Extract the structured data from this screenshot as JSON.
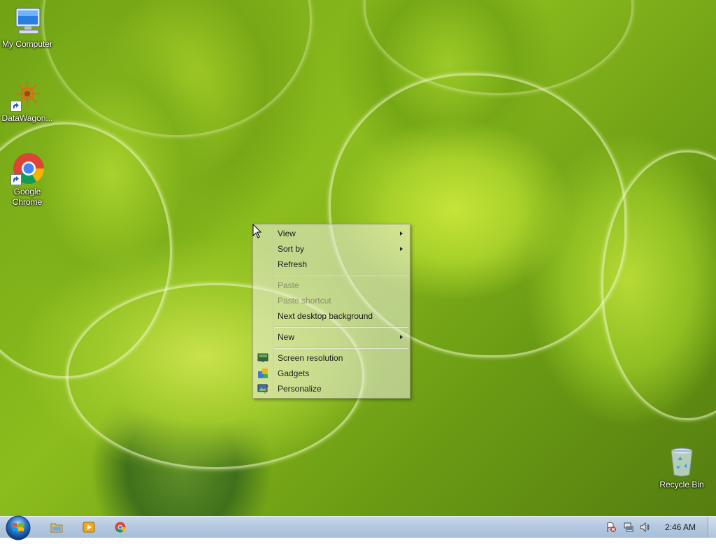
{
  "desktop": {
    "icons": [
      {
        "label": "My Computer",
        "icon": "computer-icon"
      },
      {
        "label": "DataWagon...",
        "icon": "datawagon-icon"
      },
      {
        "label": "Google Chrome",
        "icon": "chrome-icon"
      },
      {
        "label": "Recycle Bin",
        "icon": "recycle-bin-icon"
      }
    ]
  },
  "context_menu": {
    "items": [
      {
        "label": "View",
        "submenu": true,
        "disabled": false
      },
      {
        "label": "Sort by",
        "submenu": true,
        "disabled": false
      },
      {
        "label": "Refresh",
        "submenu": false,
        "disabled": false
      },
      {
        "label": "Paste",
        "submenu": false,
        "disabled": true
      },
      {
        "label": "Paste shortcut",
        "submenu": false,
        "disabled": true
      },
      {
        "label": "Next desktop background",
        "submenu": false,
        "disabled": false
      },
      {
        "label": "New",
        "submenu": true,
        "disabled": false
      },
      {
        "label": "Screen resolution",
        "submenu": false,
        "disabled": false,
        "icon": "screen-resolution-icon"
      },
      {
        "label": "Gadgets",
        "submenu": false,
        "disabled": false,
        "icon": "gadgets-icon"
      },
      {
        "label": "Personalize",
        "submenu": false,
        "disabled": false,
        "icon": "personalize-icon"
      }
    ]
  },
  "taskbar": {
    "start": "start-orb-icon",
    "pinned": [
      "file-explorer-icon",
      "media-player-icon",
      "chrome-icon"
    ],
    "tray": [
      "action-center-flag-icon",
      "network-icon",
      "volume-icon"
    ],
    "clock": "2:46 AM"
  },
  "colors": {
    "taskbar": "#b4c9e0",
    "wallpaper_green": "#8cbd1e",
    "menu_bg": "#f0f0e4"
  }
}
